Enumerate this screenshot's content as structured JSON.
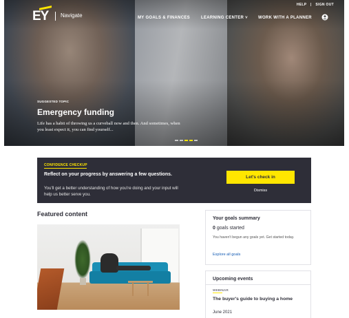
{
  "header": {
    "logo_text": "EY",
    "brand_label": "Navigate",
    "top_links": [
      "HELP",
      "|",
      "SIGN OUT"
    ],
    "main_nav": [
      {
        "label": "MY GOALS & FINANCES"
      },
      {
        "label": "LEARNING CENTER ˅"
      },
      {
        "label": "WORK WITH A PLANNER"
      }
    ],
    "user_icon": "user-circle-icon"
  },
  "hero": {
    "tag": "SUGGESTED TOPIC",
    "title": "Emergency funding",
    "text": "Life has a habit of throwing us a curveball now and then. And sometimes, when you least expect it, you can find yourself...",
    "slides_total": 5,
    "active_slide": 3
  },
  "checkup": {
    "tag": "CONFIDENCE CHECKUP",
    "heading": "Reflect on your progress by answering a few questions.",
    "body": "You'll get a better understanding of how you're doing and your input will help us better serve you.",
    "cta_label": "Let's check in",
    "dismiss_label": "Dismiss"
  },
  "featured": {
    "title": "Featured content",
    "image": "woman-on-sofa-with-laptop-photo"
  },
  "goals_summary": {
    "title": "Your goals summary",
    "count": "0",
    "count_label": "goals started",
    "description": "You haven't begun any goals yet. Get started today.",
    "link_label": "Explore all goals"
  },
  "upcoming_events": {
    "title": "Upcoming events",
    "tag": "WEBINAR",
    "event_title": "The buyer's guide to buying a home",
    "event_date": "June 2021"
  },
  "colors": {
    "brand_yellow": "#ffe600",
    "dark_panel": "#2e2e38",
    "link_blue": "#155cb4"
  }
}
